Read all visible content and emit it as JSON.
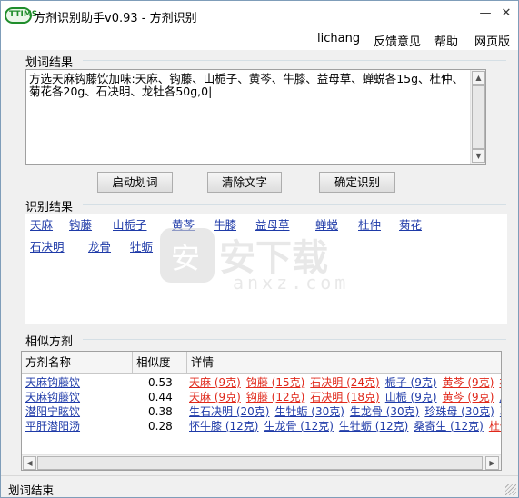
{
  "window": {
    "icon_text": "TTIMS",
    "title": "方剂识别助手v0.93 - 方剂识别",
    "min_glyph": "—",
    "close_glyph": "✕"
  },
  "menu": [
    "lichang",
    "反馈意见",
    "帮助",
    "网页版"
  ],
  "input_group": {
    "label": "划词结果",
    "text": "方选天麻钩藤饮加味:天麻、钩藤、山栀子、黄芩、牛膝、益母草、蝉蜕各15g、杜仲、菊花各20g、石决明、龙牡各50g,0|",
    "scroll_up": "▲",
    "scroll_down": "▼"
  },
  "buttons": [
    "启动划词",
    "清除文字",
    "确定识别"
  ],
  "result_group": {
    "label": "识别结果",
    "herbs_row1": [
      "天麻",
      "钩藤",
      "山栀子",
      "黄芩",
      "牛膝",
      "益母草",
      "蝉蜕",
      "杜仲",
      "菊花"
    ],
    "herbs_row2": [
      "石决明",
      "龙骨",
      "牡蛎"
    ]
  },
  "watermark": {
    "icon_text": "安",
    "text": "安下载",
    "sub": "anxz.com"
  },
  "similar_group": {
    "label": "相似方剂",
    "columns": [
      "方剂名称",
      "相似度",
      "详情"
    ],
    "rows": [
      {
        "name": "天麻钩藤饮",
        "score": "0.53",
        "details": [
          {
            "t": "天麻 (9克)",
            "c": "red"
          },
          {
            "t": "钩藤 (15克)",
            "c": "red"
          },
          {
            "t": "石决明 (24克)",
            "c": "red"
          },
          {
            "t": "栀子 (9克)",
            "c": "blue"
          },
          {
            "t": "黄芩 (9克)",
            "c": "red"
          },
          {
            "t": "杜",
            "c": "red"
          }
        ]
      },
      {
        "name": "天麻钩藤饮",
        "score": "0.44",
        "details": [
          {
            "t": "天麻 (9克)",
            "c": "red"
          },
          {
            "t": "钩藤 (12克)",
            "c": "red"
          },
          {
            "t": "石决明 (18克)",
            "c": "red"
          },
          {
            "t": "山栀 (9克)",
            "c": "blue"
          },
          {
            "t": "黄芩 (9克)",
            "c": "red"
          },
          {
            "t": "川",
            "c": "blue"
          }
        ]
      },
      {
        "name": "潜阳宁眩饮",
        "score": "0.38",
        "details": [
          {
            "t": "生石决明 (20克)",
            "c": "blue"
          },
          {
            "t": "生牡蛎 (30克)",
            "c": "blue"
          },
          {
            "t": "生龙骨 (30克)",
            "c": "blue"
          },
          {
            "t": "珍珠母 (30克)",
            "c": "blue"
          },
          {
            "t": "葛",
            "c": "blue"
          }
        ]
      },
      {
        "name": "平肝潜阳汤",
        "score": "0.28",
        "details": [
          {
            "t": "怀牛膝 (12克)",
            "c": "blue"
          },
          {
            "t": "生龙骨 (12克)",
            "c": "blue"
          },
          {
            "t": "生牡蛎 (12克)",
            "c": "blue"
          },
          {
            "t": "桑寄生 (12克)",
            "c": "blue"
          },
          {
            "t": "杜仲",
            "c": "red"
          }
        ]
      }
    ],
    "scroll_left": "◀",
    "scroll_right": "▶"
  },
  "status": "划词结束",
  "colors": {
    "link_blue": "#1e3aa8",
    "match_red": "#e0281b",
    "icon_green": "#1f8d2b"
  }
}
